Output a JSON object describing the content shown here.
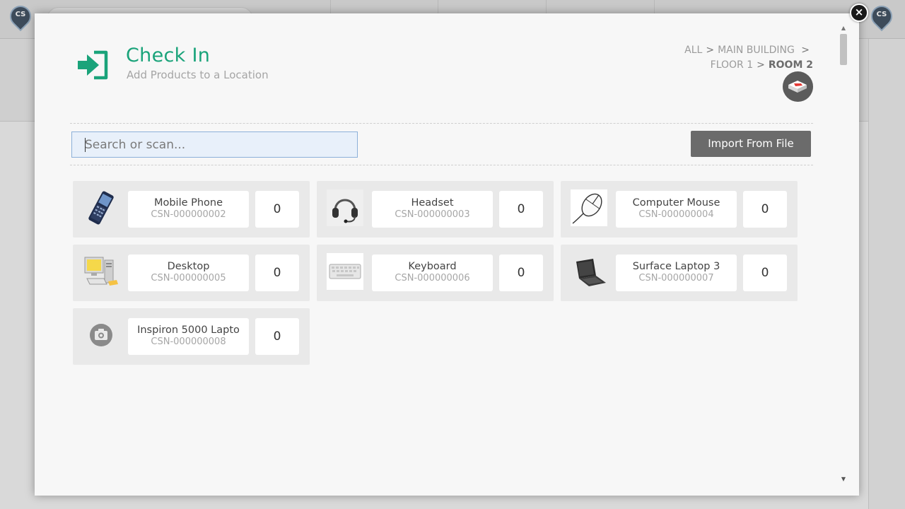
{
  "app": {
    "logo_text": "CS"
  },
  "modal": {
    "title": "Check In",
    "subtitle": "Add Products to a Location",
    "close_icon": "×",
    "breadcrumb": {
      "items": [
        "ALL",
        "MAIN BUILDING",
        "FLOOR 1"
      ],
      "current": "ROOM 2",
      "separator": ">"
    },
    "search": {
      "placeholder": "Search or scan...",
      "value": ""
    },
    "import_label": "Import From File",
    "products": [
      {
        "name": "Mobile Phone",
        "code": "CSN-000000002",
        "qty": "0",
        "icon": "mobile-phone-icon"
      },
      {
        "name": "Headset",
        "code": "CSN-000000003",
        "qty": "0",
        "icon": "headset-icon"
      },
      {
        "name": "Computer Mouse",
        "code": "CSN-000000004",
        "qty": "0",
        "icon": "computer-mouse-icon"
      },
      {
        "name": "Desktop",
        "code": "CSN-000000005",
        "qty": "0",
        "icon": "desktop-icon"
      },
      {
        "name": "Keyboard",
        "code": "CSN-000000006",
        "qty": "0",
        "icon": "keyboard-icon"
      },
      {
        "name": "Surface Laptop 3",
        "code": "CSN-000000007",
        "qty": "0",
        "icon": "laptop-icon"
      },
      {
        "name": "Inspiron 5000 Lapto",
        "code": "CSN-000000008",
        "qty": "0",
        "icon": "camera-placeholder-icon"
      }
    ]
  },
  "colors": {
    "accent": "#1aa37a",
    "button": "#6b6b6b",
    "tile": "#e9e9e9"
  }
}
